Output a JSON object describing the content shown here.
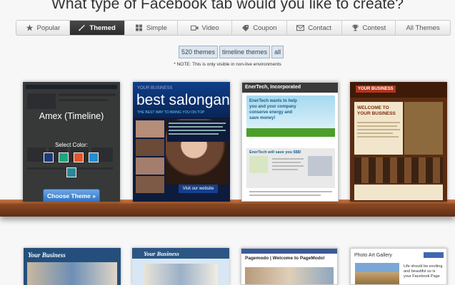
{
  "page": {
    "title": "What type of Facebook tab would you like to create?"
  },
  "tabs": [
    {
      "label": "Popular",
      "icon": "star-icon",
      "active": false
    },
    {
      "label": "Themed",
      "icon": "brush-icon",
      "active": true
    },
    {
      "label": "Simple",
      "icon": "grid-icon",
      "active": false
    },
    {
      "label": "Video",
      "icon": "video-camera-icon",
      "active": false
    },
    {
      "label": "Coupon",
      "icon": "coupon-tag-icon",
      "active": false
    },
    {
      "label": "Contact",
      "icon": "envelope-icon",
      "active": false
    },
    {
      "label": "Contest",
      "icon": "trophy-icon",
      "active": false
    },
    {
      "label": "All Themes",
      "icon": "",
      "active": false
    }
  ],
  "filters": [
    "520 themes",
    "timeline themes",
    "all"
  ],
  "note": "* NOTE: This is only visible in non-live environments",
  "shelf1": {
    "amex": {
      "name": "Amex (Timeline)",
      "select_color_label": "Select Color:",
      "swatches": [
        "#1e3a78",
        "#1aa87f",
        "#e2562b",
        "#1f8fd6",
        "#2a8a98"
      ],
      "button": "Choose Theme »"
    },
    "salon": {
      "badge": "YOUR BUSINESS",
      "brand": "best salongan",
      "tagline": "THE BEST WAY TO BRING YOU ON TOP",
      "cta": "Visit our website"
    },
    "enertech": {
      "header": "EnerTech, Incorporated",
      "banner": "EnerTech wants to help you and your company conserve energy and save money!",
      "sub": "EnerTech will save you $$$!"
    },
    "wood": {
      "tag": "YOUR BUSINESS",
      "welcome": "WELCOME TO YOUR BUSINESS"
    }
  },
  "shelf2": {
    "b1": {
      "title": "Your Business"
    },
    "b2": {
      "title": "Your Business"
    },
    "b3": {
      "title": "Pagemodo | Welcome to PageModo!"
    },
    "b4": {
      "title": "Photo Art Gallery",
      "text": "Life should be exciting and beautiful so is your Facebook Page"
    }
  }
}
